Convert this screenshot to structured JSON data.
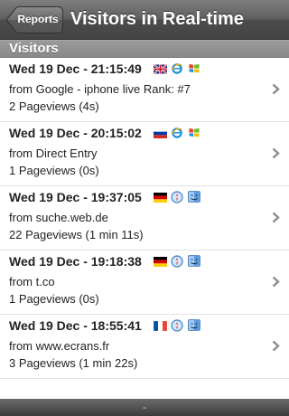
{
  "nav": {
    "back_label": "Reports",
    "title": "Visitors in Real-time"
  },
  "section": {
    "title": "Visitors"
  },
  "visitors": [
    {
      "time": "Wed 19 Dec - 21:15:49",
      "from": "from Google - iphone live Rank: #7",
      "pageviews": "2 Pageviews (4s)",
      "flag": "uk-flag-icon",
      "browser": "internet-explorer-icon",
      "os": "windows-icon"
    },
    {
      "time": "Wed 19 Dec - 20:15:02",
      "from": "from Direct Entry",
      "pageviews": "1 Pageviews (0s)",
      "flag": "russia-flag-icon",
      "browser": "internet-explorer-icon",
      "os": "windows-icon"
    },
    {
      "time": "Wed 19 Dec - 19:37:05",
      "from": "from suche.web.de",
      "pageviews": "22 Pageviews (1 min 11s)",
      "flag": "germany-flag-icon",
      "browser": "safari-icon",
      "os": "mac-finder-icon"
    },
    {
      "time": "Wed 19 Dec - 19:18:38",
      "from": "from t.co",
      "pageviews": "1 Pageviews (0s)",
      "flag": "germany-flag-icon",
      "browser": "safari-icon",
      "os": "mac-finder-icon"
    },
    {
      "time": "Wed 19 Dec - 18:55:41",
      "from": "from www.ecrans.fr",
      "pageviews": "3 Pageviews (1 min 22s)",
      "flag": "france-flag-icon",
      "browser": "safari-icon",
      "os": "mac-finder-icon"
    }
  ],
  "toolbar": {
    "label": "-"
  }
}
